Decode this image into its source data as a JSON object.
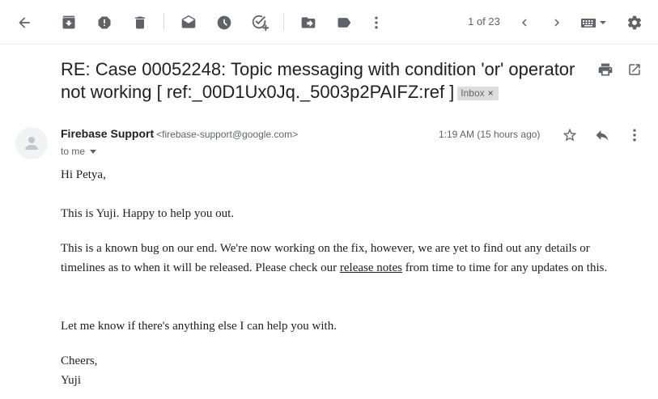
{
  "toolbar": {
    "pager": "1 of 23"
  },
  "subject": {
    "line1": "RE: Case 00052248: Topic messaging with condition 'or' operator",
    "line2": "not working [ ref:_00D1Ux0Jq._5003p2PAIFZ:ref ]",
    "label": "Inbox",
    "label_close": "×"
  },
  "message": {
    "sender_name": "Firebase Support",
    "sender_email": "<firebase-support@google.com>",
    "recipient": "to me",
    "timestamp": "1:19 AM (15 hours ago)"
  },
  "body": {
    "greeting": "Hi Petya,",
    "p1": "This is Yuji. Happy to help you out.",
    "p2_before": "This is a known bug on our end. We're now working on the fix, however, we are yet to find out any details or timelines as to when it will be released. Please check our ",
    "p2_link": "release notes",
    "p2_after": " from time to time for any updates on this.",
    "p3": "Let me know if there's anything else I can help you with.",
    "signoff": "Cheers,",
    "signature": "Yuji"
  },
  "icons": {
    "toolbar": [
      "back-arrow-icon",
      "archive-icon",
      "report-spam-icon",
      "delete-icon",
      "mark-unread-icon",
      "snooze-icon",
      "add-task-icon",
      "move-to-icon",
      "labels-icon",
      "more-vert-icon",
      "prev-icon",
      "next-icon",
      "input-tools-icon",
      "settings-icon"
    ],
    "subject": [
      "print-icon",
      "open-new-window-icon"
    ],
    "message": [
      "star-icon",
      "reply-icon",
      "more-vert-icon"
    ]
  },
  "colors": {
    "icon": "#5f6368",
    "text": "#202124",
    "secondary": "#5f6368",
    "chip_bg": "#dddddd"
  }
}
